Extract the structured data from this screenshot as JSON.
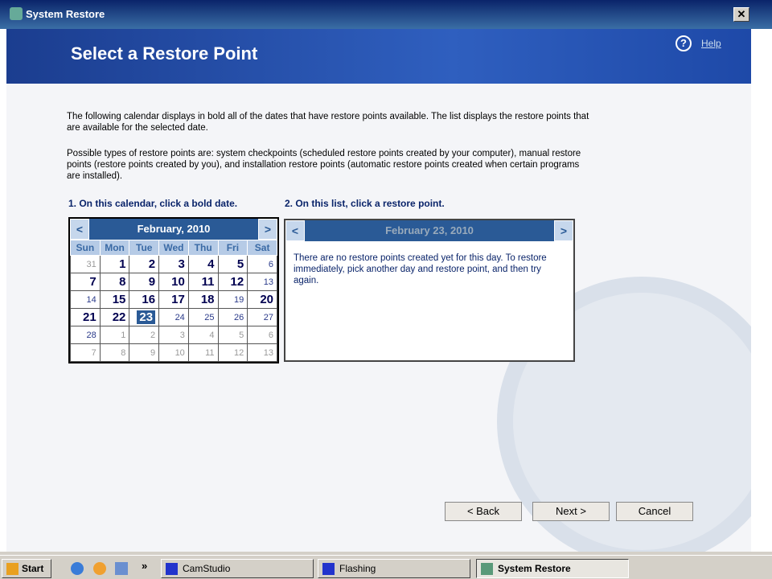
{
  "window": {
    "title": "System Restore",
    "close": "✕"
  },
  "header": {
    "title": "Select a Restore Point",
    "help": "Help",
    "help_icon": "?"
  },
  "intro": "The following calendar displays in bold all of the dates that have restore points available. The list displays the restore points that are available for the selected date.",
  "types": "Possible types of restore points are: system checkpoints (scheduled restore points created by your computer), manual restore points (restore points created by you), and installation restore points (automatic restore points created when certain programs are installed).",
  "step1": "1. On this calendar, click a bold date.",
  "step2": "2. On this list, click a restore point.",
  "calendar": {
    "month": "February, 2010",
    "prev": "<",
    "next": ">",
    "days": [
      "Sun",
      "Mon",
      "Tue",
      "Wed",
      "Thu",
      "Fri",
      "Sat"
    ],
    "weeks": [
      [
        [
          "31",
          "o"
        ],
        [
          "1",
          "b"
        ],
        [
          "2",
          "b"
        ],
        [
          "3",
          "b"
        ],
        [
          "4",
          "b"
        ],
        [
          "5",
          "b"
        ],
        [
          "6",
          "n"
        ]
      ],
      [
        [
          "7",
          "b"
        ],
        [
          "8",
          "b"
        ],
        [
          "9",
          "b"
        ],
        [
          "10",
          "b"
        ],
        [
          "11",
          "b"
        ],
        [
          "12",
          "b"
        ],
        [
          "13",
          "n"
        ]
      ],
      [
        [
          "14",
          "n"
        ],
        [
          "15",
          "b"
        ],
        [
          "16",
          "b"
        ],
        [
          "17",
          "b"
        ],
        [
          "18",
          "b"
        ],
        [
          "19",
          "n"
        ],
        [
          "20",
          "b"
        ]
      ],
      [
        [
          "21",
          "b"
        ],
        [
          "22",
          "b"
        ],
        [
          "23",
          "s"
        ],
        [
          "24",
          "n"
        ],
        [
          "25",
          "n"
        ],
        [
          "26",
          "n"
        ],
        [
          "27",
          "n"
        ]
      ],
      [
        [
          "28",
          "n"
        ],
        [
          "1",
          "o"
        ],
        [
          "2",
          "o"
        ],
        [
          "3",
          "o"
        ],
        [
          "4",
          "o"
        ],
        [
          "5",
          "o"
        ],
        [
          "6",
          "o"
        ]
      ],
      [
        [
          "7",
          "o"
        ],
        [
          "8",
          "o"
        ],
        [
          "9",
          "o"
        ],
        [
          "10",
          "o"
        ],
        [
          "11",
          "o"
        ],
        [
          "12",
          "o"
        ],
        [
          "13",
          "o"
        ]
      ]
    ]
  },
  "list": {
    "date": "February 23, 2010",
    "prev": "<",
    "next": ">",
    "message": "There are no restore points created yet for this day. To restore immediately, pick another day and restore point, and then try again."
  },
  "buttons": {
    "back": "< Back",
    "next": "Next >",
    "cancel": "Cancel"
  },
  "taskbar": {
    "start": "Start",
    "more": "»",
    "items": [
      "CamStudio",
      "Flashing",
      "System Restore"
    ]
  }
}
